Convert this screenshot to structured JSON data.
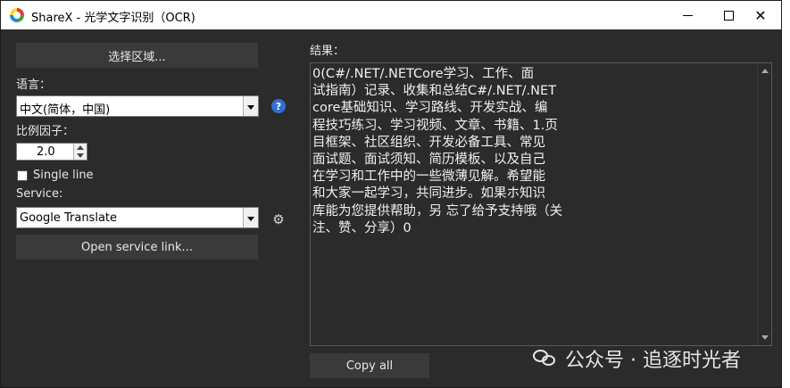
{
  "window": {
    "title": "ShareX - 光学文字识别（OCR)",
    "controls": {
      "minimize": "minimize",
      "maximize": "maximize",
      "close": "✕"
    }
  },
  "left_panel": {
    "select_region_button": "选择区域...",
    "language_label": "语言：",
    "language_value": "中文(简体，中国)",
    "scale_label": "比例因子：",
    "scale_value": "2.0",
    "single_line_label": "Single line",
    "single_line_checked": false,
    "service_label": "Service:",
    "service_value": "Google Translate",
    "open_service_button": "Open service link..."
  },
  "result": {
    "label": "结果：",
    "text": "0(C#/.NET/.NETCore学习、工作、面\n试指南）记录、收集和总结C#/.NET/.NET\ncore基础知识、学习路线、开发实战、编\n程技巧练习、学习视频、文章、书籍、1.页\n目框架、社区组织、开发必备工具、常见\n面试题、面试须知、简历模板、以及自己\n在学习和工作中的一些微薄见解。希望能\n和大家一起学习，共同进步。如果ホ知识\n库能为您提供帮助，另 忘了给予支持哦（关\n注、赞、分享）0",
    "copy_button": "Copy all"
  },
  "watermark": {
    "text": "公众号 · 追逐时光者"
  },
  "icons": {
    "app": "sharex-logo-icon",
    "help": "help-icon",
    "settings": "gear-icon",
    "wechat": "wechat-icon"
  },
  "colors": {
    "window_bg": "#2b2b2b",
    "button_bg": "#3a3a3a",
    "help_blue": "#2f6fd6"
  }
}
